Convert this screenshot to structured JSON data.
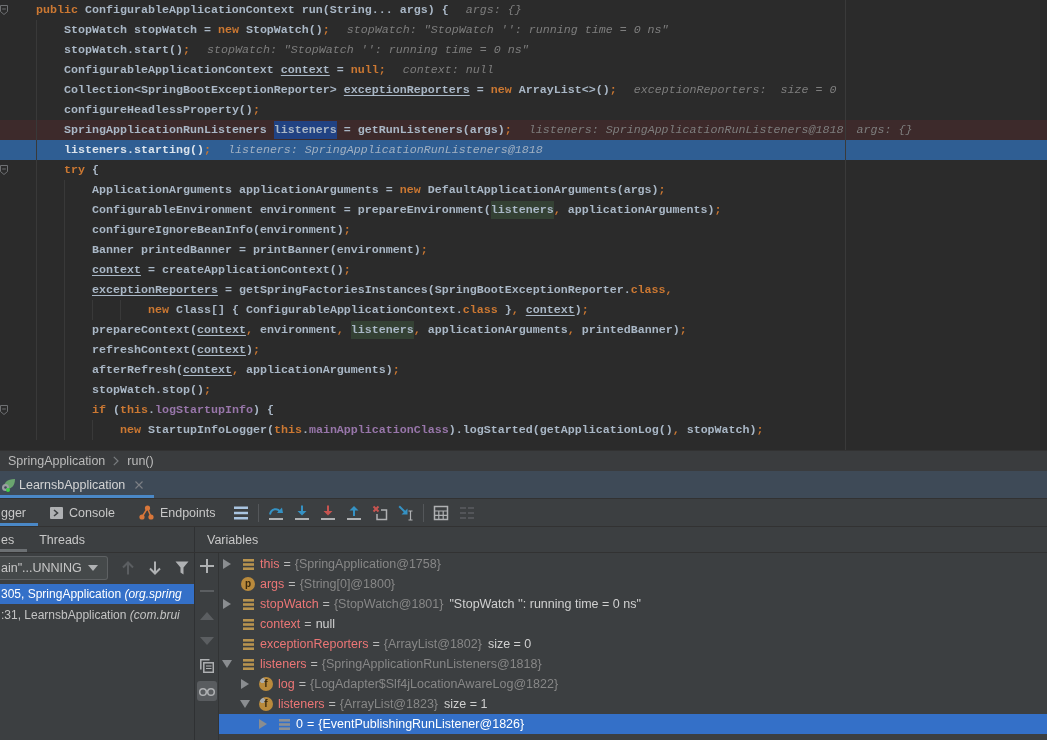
{
  "editor": {
    "lines": [
      {
        "segments": [
          {
            "kind": "keyword",
            "text": "public"
          },
          {
            "kind": "plain",
            "text": " ConfigurableApplicationContext run(String... args) {"
          }
        ],
        "hints": [
          "args: {}"
        ],
        "fold": true,
        "breakpoint": false,
        "current": false,
        "children": [
          {
            "segments": [
              {
                "kind": "plain",
                "text": "StopWatch stopWatch = "
              },
              {
                "kind": "keyword",
                "text": "new"
              },
              {
                "kind": "plain",
                "text": " StopWatch()"
              },
              {
                "kind": "keyword",
                "text": ";"
              }
            ],
            "hints": [
              "stopWatch: \"StopWatch '': running time = 0 ns\""
            ],
            "fold": false,
            "breakpoint": false,
            "current": false
          },
          {
            "segments": [
              {
                "kind": "plain",
                "text": "stopWatch.start()"
              },
              {
                "kind": "keyword",
                "text": ";"
              }
            ],
            "hints": [
              "stopWatch: \"StopWatch '': running time = 0 ns\""
            ],
            "fold": false,
            "breakpoint": false,
            "current": false
          },
          {
            "segments": [
              {
                "kind": "plain",
                "text": "ConfigurableApplicationContext "
              },
              {
                "kind": "reassigned",
                "text": "context"
              },
              {
                "kind": "plain",
                "text": " = "
              },
              {
                "kind": "keyword",
                "text": "null;"
              }
            ],
            "hints": [
              "context: null"
            ],
            "fold": false,
            "breakpoint": false,
            "current": false
          },
          {
            "segments": [
              {
                "kind": "plain",
                "text": "Collection<SpringBootExceptionReporter> "
              },
              {
                "kind": "reassigned",
                "text": "exceptionReporters"
              },
              {
                "kind": "plain",
                "text": " = "
              },
              {
                "kind": "keyword",
                "text": "new"
              },
              {
                "kind": "plain",
                "text": " ArrayList<>()"
              },
              {
                "kind": "keyword",
                "text": ";"
              }
            ],
            "hints": [
              "exceptionReporters:  size = 0"
            ],
            "fold": false,
            "breakpoint": false,
            "current": false
          },
          {
            "segments": [
              {
                "kind": "plain",
                "text": "configureHeadlessProperty()"
              },
              {
                "kind": "keyword",
                "text": ";"
              }
            ],
            "fold": false,
            "breakpoint": false,
            "current": false
          },
          {
            "segments": [
              {
                "kind": "plain",
                "text": "SpringApplicationRunListeners "
              },
              {
                "kind": "selection",
                "text": "listeners"
              },
              {
                "kind": "plain",
                "text": " = getRunListeners(args)"
              },
              {
                "kind": "keyword",
                "text": ";"
              }
            ],
            "hints": [
              "listeners: SpringApplicationRunListeners@1818",
              "args: {}"
            ],
            "fold": false,
            "breakpoint": true,
            "current": false
          },
          {
            "segments": [
              {
                "kind": "plain",
                "text": "listeners.starting()"
              },
              {
                "kind": "keyword",
                "text": ";"
              }
            ],
            "hints": [
              "listeners: SpringApplicationRunListeners@1818"
            ],
            "fold": false,
            "breakpoint": false,
            "current": true
          },
          {
            "segments": [
              {
                "kind": "keyword",
                "text": "try"
              },
              {
                "kind": "plain",
                "text": " {"
              }
            ],
            "fold": true,
            "breakpoint": false,
            "current": false,
            "children": [
              {
                "segments": [
                  {
                    "kind": "plain",
                    "text": "ApplicationArguments applicationArguments = "
                  },
                  {
                    "kind": "keyword",
                    "text": "new"
                  },
                  {
                    "kind": "plain",
                    "text": " DefaultApplicationArguments(args)"
                  },
                  {
                    "kind": "keyword",
                    "text": ";"
                  }
                ],
                "fold": false,
                "breakpoint": false,
                "current": false
              },
              {
                "segments": [
                  {
                    "kind": "plain",
                    "text": "ConfigurableEnvironment environment = prepareEnvironment("
                  },
                  {
                    "kind": "usage",
                    "text": "listeners"
                  },
                  {
                    "kind": "keyword",
                    "text": ","
                  },
                  {
                    "kind": "plain",
                    "text": " applicationArguments)"
                  },
                  {
                    "kind": "keyword",
                    "text": ";"
                  }
                ],
                "fold": false,
                "breakpoint": false,
                "current": false
              },
              {
                "segments": [
                  {
                    "kind": "plain",
                    "text": "configureIgnoreBeanInfo(environment)"
                  },
                  {
                    "kind": "keyword",
                    "text": ";"
                  }
                ],
                "fold": false,
                "breakpoint": false,
                "current": false
              },
              {
                "segments": [
                  {
                    "kind": "plain",
                    "text": "Banner printedBanner = printBanner(environment)"
                  },
                  {
                    "kind": "keyword",
                    "text": ";"
                  }
                ],
                "fold": false,
                "breakpoint": false,
                "current": false
              },
              {
                "segments": [
                  {
                    "kind": "reassigned",
                    "text": "context"
                  },
                  {
                    "kind": "plain",
                    "text": " = createApplicationContext()"
                  },
                  {
                    "kind": "keyword",
                    "text": ";"
                  }
                ],
                "fold": false,
                "breakpoint": false,
                "current": false
              },
              {
                "segments": [
                  {
                    "kind": "reassigned",
                    "text": "exceptionReporters"
                  },
                  {
                    "kind": "plain",
                    "text": " = getSpringFactoriesInstances(SpringBootExceptionReporter."
                  },
                  {
                    "kind": "keyword",
                    "text": "class,"
                  }
                ],
                "fold": false,
                "breakpoint": false,
                "current": false,
                "children": [
                  {
                    "kind": "continuation",
                    "segments": [
                      {
                        "kind": "keyword",
                        "text": "new"
                      },
                      {
                        "kind": "plain",
                        "text": " Class[] { ConfigurableApplicationContext."
                      },
                      {
                        "kind": "keyword",
                        "text": "class"
                      },
                      {
                        "kind": "plain",
                        "text": " }"
                      },
                      {
                        "kind": "keyword",
                        "text": ", "
                      },
                      {
                        "kind": "reassigned",
                        "text": "context"
                      },
                      {
                        "kind": "plain",
                        "text": ")"
                      },
                      {
                        "kind": "keyword",
                        "text": ";"
                      }
                    ],
                    "fold": false,
                    "breakpoint": false,
                    "current": false
                  }
                ]
              },
              {
                "segments": [
                  {
                    "kind": "plain",
                    "text": "prepareContext("
                  },
                  {
                    "kind": "reassigned",
                    "text": "context"
                  },
                  {
                    "kind": "keyword",
                    "text": ","
                  },
                  {
                    "kind": "plain",
                    "text": " environment"
                  },
                  {
                    "kind": "keyword",
                    "text": ", "
                  },
                  {
                    "kind": "usage",
                    "text": "listeners"
                  },
                  {
                    "kind": "keyword",
                    "text": ","
                  },
                  {
                    "kind": "plain",
                    "text": " applicationArguments"
                  },
                  {
                    "kind": "keyword",
                    "text": ","
                  },
                  {
                    "kind": "plain",
                    "text": " printedBanner)"
                  },
                  {
                    "kind": "keyword",
                    "text": ";"
                  }
                ],
                "fold": false,
                "breakpoint": false,
                "current": false
              },
              {
                "segments": [
                  {
                    "kind": "plain",
                    "text": "refreshContext("
                  },
                  {
                    "kind": "reassigned",
                    "text": "context"
                  },
                  {
                    "kind": "plain",
                    "text": ")"
                  },
                  {
                    "kind": "keyword",
                    "text": ";"
                  }
                ],
                "fold": false,
                "breakpoint": false,
                "current": false
              },
              {
                "segments": [
                  {
                    "kind": "plain",
                    "text": "afterRefresh("
                  },
                  {
                    "kind": "reassigned",
                    "text": "context"
                  },
                  {
                    "kind": "keyword",
                    "text": ","
                  },
                  {
                    "kind": "plain",
                    "text": " applicationArguments)"
                  },
                  {
                    "kind": "keyword",
                    "text": ";"
                  }
                ],
                "fold": false,
                "breakpoint": false,
                "current": false
              },
              {
                "segments": [
                  {
                    "kind": "plain",
                    "text": "stopWatch.stop()"
                  },
                  {
                    "kind": "keyword",
                    "text": ";"
                  }
                ],
                "fold": false,
                "breakpoint": false,
                "current": false
              },
              {
                "segments": [
                  {
                    "kind": "keyword",
                    "text": "if"
                  },
                  {
                    "kind": "plain",
                    "text": " ("
                  },
                  {
                    "kind": "keyword",
                    "text": "this"
                  },
                  {
                    "kind": "plain",
                    "text": "."
                  },
                  {
                    "kind": "field",
                    "text": "logStartupInfo"
                  },
                  {
                    "kind": "plain",
                    "text": ") {"
                  }
                ],
                "fold": true,
                "breakpoint": false,
                "current": false,
                "children": [
                  {
                    "segments": [
                      {
                        "kind": "keyword",
                        "text": "new"
                      },
                      {
                        "kind": "plain",
                        "text": " StartupInfoLogger("
                      },
                      {
                        "kind": "keyword",
                        "text": "this"
                      },
                      {
                        "kind": "plain",
                        "text": "."
                      },
                      {
                        "kind": "field",
                        "text": "mainApplicationClass"
                      },
                      {
                        "kind": "plain",
                        "text": ").logStarted(getApplicationLog()"
                      },
                      {
                        "kind": "keyword",
                        "text": ","
                      },
                      {
                        "kind": "plain",
                        "text": " stopWatch)"
                      },
                      {
                        "kind": "keyword",
                        "text": ";"
                      }
                    ],
                    "fold": false,
                    "breakpoint": false,
                    "current": false
                  }
                ]
              }
            ]
          }
        ]
      }
    ]
  },
  "breadcrumb": [
    {
      "label": "SpringApplication"
    },
    {
      "label": "run()"
    }
  ],
  "run_tabs": [
    {
      "label": "LearnsbApplication",
      "selected": true
    }
  ],
  "debugger": {
    "tabs": [
      {
        "kind": "debugger",
        "label": "gger",
        "selected": true
      },
      {
        "kind": "console",
        "label": "Console",
        "selected": false
      },
      {
        "kind": "endpoints",
        "label": "Endpoints",
        "selected": false
      }
    ],
    "toolbar": [
      [
        {
          "kind": "layout",
          "disabled": false
        }
      ],
      [
        {
          "kind": "step-over",
          "disabled": false
        },
        {
          "kind": "step-into",
          "disabled": false
        },
        {
          "kind": "force-step-into",
          "disabled": false
        },
        {
          "kind": "step-out",
          "disabled": false
        },
        {
          "kind": "drop-frame",
          "disabled": false
        },
        {
          "kind": "run-to-cursor",
          "disabled": false
        }
      ],
      [
        {
          "kind": "evaluate",
          "disabled": false
        },
        {
          "kind": "trace",
          "disabled": true
        }
      ]
    ]
  },
  "frames_panel": {
    "tabs": [
      {
        "label": "es",
        "selected": true
      },
      {
        "label": "Threads",
        "selected": false
      }
    ],
    "thread_selector": {
      "value": "ain\"...UNNING"
    },
    "toolbar": [
      {
        "kind": "up",
        "disabled": true
      },
      {
        "kind": "down",
        "disabled": false
      },
      {
        "kind": "filter",
        "disabled": false
      }
    ],
    "frames": [
      {
        "text": "305, SpringApplication *(org.spring*",
        "selected": true
      },
      {
        "text": ":31, LearnsbApplication *(com.brui*",
        "selected": false
      }
    ]
  },
  "variables_panel": {
    "title": "Variables",
    "toolbar": [
      {
        "kind": "add",
        "disabled": false
      },
      {
        "kind": "remove",
        "disabled": true
      },
      {
        "kind": "up",
        "disabled": true
      },
      {
        "kind": "down",
        "disabled": true
      },
      {
        "kind": "copy",
        "disabled": false
      },
      {
        "kind": "watches",
        "disabled": false,
        "on": true
      }
    ],
    "items": [
      {
        "kind": "local",
        "name": "this",
        "separator": "=",
        "type": "{SpringApplication@1758}",
        "expanded": false,
        "selected": false
      },
      {
        "kind": "param",
        "letter": "p",
        "name": "args",
        "separator": "=",
        "type": "{String[0]@1800}",
        "selected": false
      },
      {
        "kind": "local",
        "name": "stopWatch",
        "separator": "=",
        "type": "{StopWatch@1801}",
        "value": "\"StopWatch '': running time = 0 ns\"",
        "expanded": false,
        "selected": false
      },
      {
        "kind": "local",
        "name": "context",
        "separator": "=",
        "value": "null",
        "selected": false
      },
      {
        "kind": "local",
        "name": "exceptionReporters",
        "separator": "=",
        "type": "{ArrayList@1802}",
        "value": "size = 0",
        "selected": false
      },
      {
        "kind": "local",
        "name": "listeners",
        "separator": "=",
        "type": "{SpringApplicationRunListeners@1818}",
        "expanded": true,
        "selected": false,
        "children": [
          {
            "kind": "field",
            "letter": "f",
            "name": "log",
            "separator": "=",
            "type": "{LogAdapter$Slf4jLocationAwareLog@1822}",
            "expanded": false,
            "selected": false
          },
          {
            "kind": "field",
            "letter": "f",
            "name": "listeners",
            "separator": "=",
            "type": "{ArrayList@1823}",
            "value": "size = 1",
            "expanded": true,
            "selected": false,
            "children": [
              {
                "kind": "element",
                "name": "0",
                "separator": "=",
                "type": "{EventPublishingRunListener@1826}",
                "expanded": false,
                "selected": true
              }
            ]
          }
        ]
      }
    ]
  }
}
